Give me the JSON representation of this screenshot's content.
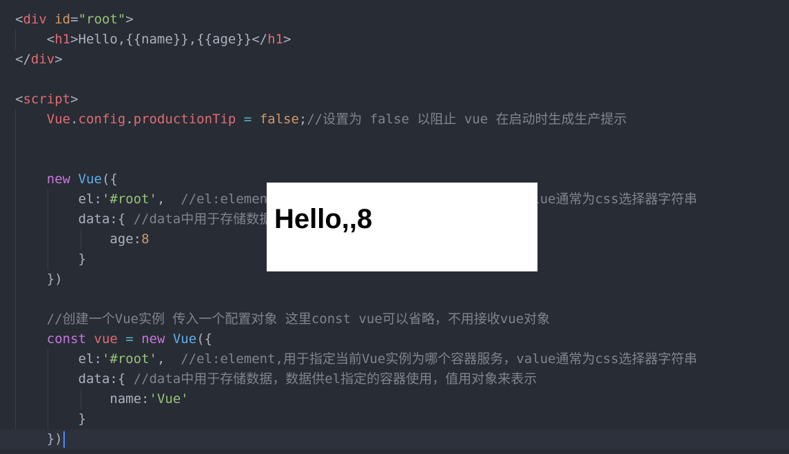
{
  "editor": {
    "lines": [
      [
        {
          "t": "<",
          "c": "t-punct"
        },
        {
          "t": "div",
          "c": "t-tag"
        },
        {
          "t": " ",
          "c": "t-text"
        },
        {
          "t": "id",
          "c": "t-attr"
        },
        {
          "t": "=",
          "c": "t-punct"
        },
        {
          "t": "\"root\"",
          "c": "t-str"
        },
        {
          "t": ">",
          "c": "t-punct"
        }
      ],
      [
        {
          "t": "    <",
          "c": "t-punct"
        },
        {
          "t": "h1",
          "c": "t-tag"
        },
        {
          "t": ">",
          "c": "t-punct"
        },
        {
          "t": "Hello,{{name}},{{age}}",
          "c": "t-text"
        },
        {
          "t": "</",
          "c": "t-punct"
        },
        {
          "t": "h1",
          "c": "t-tag"
        },
        {
          "t": ">",
          "c": "t-punct"
        }
      ],
      [
        {
          "t": "</",
          "c": "t-punct"
        },
        {
          "t": "div",
          "c": "t-tag"
        },
        {
          "t": ">",
          "c": "t-punct"
        }
      ],
      [],
      [
        {
          "t": "<",
          "c": "t-punct"
        },
        {
          "t": "script",
          "c": "t-tag"
        },
        {
          "t": ">",
          "c": "t-punct"
        }
      ],
      [
        {
          "t": "    ",
          "c": "t-text"
        },
        {
          "t": "Vue",
          "c": "t-var"
        },
        {
          "t": ".",
          "c": "t-punct"
        },
        {
          "t": "config",
          "c": "t-var"
        },
        {
          "t": ".",
          "c": "t-punct"
        },
        {
          "t": "productionTip",
          "c": "t-var"
        },
        {
          "t": " = ",
          "c": "t-op"
        },
        {
          "t": "false",
          "c": "t-bool"
        },
        {
          "t": ";",
          "c": "t-punct"
        },
        {
          "t": "//设置为 false 以阻止 vue 在启动时生成生产提示",
          "c": "t-comment"
        }
      ],
      [],
      [],
      [
        {
          "t": "    ",
          "c": "t-text"
        },
        {
          "t": "new",
          "c": "t-kw"
        },
        {
          "t": " ",
          "c": "t-text"
        },
        {
          "t": "Vue",
          "c": "t-fn"
        },
        {
          "t": "({",
          "c": "t-punct"
        }
      ],
      [
        {
          "t": "        ",
          "c": "t-text"
        },
        {
          "t": "el",
          "c": "t-prop"
        },
        {
          "t": ":",
          "c": "t-punct"
        },
        {
          "t": "'#root'",
          "c": "t-str"
        },
        {
          "t": ",  ",
          "c": "t-punct"
        },
        {
          "t": "//el:element,用于指定当前Vue实例为哪个容器服务，value通常为css选择器字符串",
          "c": "t-comment"
        }
      ],
      [
        {
          "t": "        ",
          "c": "t-text"
        },
        {
          "t": "data",
          "c": "t-prop"
        },
        {
          "t": ":{ ",
          "c": "t-punct"
        },
        {
          "t": "//data中用于存储数据，数据供el指定的容器使用，值用对象来表示",
          "c": "t-comment"
        }
      ],
      [
        {
          "t": "            ",
          "c": "t-text"
        },
        {
          "t": "age",
          "c": "t-prop"
        },
        {
          "t": ":",
          "c": "t-punct"
        },
        {
          "t": "8",
          "c": "t-num"
        }
      ],
      [
        {
          "t": "        }",
          "c": "t-punct"
        }
      ],
      [
        {
          "t": "    })",
          "c": "t-punct"
        }
      ],
      [],
      [
        {
          "t": "    ",
          "c": "t-text"
        },
        {
          "t": "//创建一个Vue实例 传入一个配置对象 这里const vue可以省略，不用接收vue对象",
          "c": "t-comment"
        }
      ],
      [
        {
          "t": "    ",
          "c": "t-text"
        },
        {
          "t": "const",
          "c": "t-kw"
        },
        {
          "t": " ",
          "c": "t-text"
        },
        {
          "t": "vue",
          "c": "t-var"
        },
        {
          "t": " = ",
          "c": "t-op"
        },
        {
          "t": "new",
          "c": "t-kw"
        },
        {
          "t": " ",
          "c": "t-text"
        },
        {
          "t": "Vue",
          "c": "t-fn"
        },
        {
          "t": "({",
          "c": "t-punct"
        }
      ],
      [
        {
          "t": "        ",
          "c": "t-text"
        },
        {
          "t": "el",
          "c": "t-prop"
        },
        {
          "t": ":",
          "c": "t-punct"
        },
        {
          "t": "'#root'",
          "c": "t-str"
        },
        {
          "t": ",  ",
          "c": "t-punct"
        },
        {
          "t": "//el:element,用于指定当前Vue实例为哪个容器服务，value通常为css选择器字符串",
          "c": "t-comment"
        }
      ],
      [
        {
          "t": "        ",
          "c": "t-text"
        },
        {
          "t": "data",
          "c": "t-prop"
        },
        {
          "t": ":{ ",
          "c": "t-punct"
        },
        {
          "t": "//data中用于存储数据，数据供el指定的容器使用，值用对象来表示",
          "c": "t-comment"
        }
      ],
      [
        {
          "t": "            ",
          "c": "t-text"
        },
        {
          "t": "name",
          "c": "t-prop"
        },
        {
          "t": ":",
          "c": "t-punct"
        },
        {
          "t": "'Vue'",
          "c": "t-str"
        }
      ],
      [
        {
          "t": "        }",
          "c": "t-punct"
        }
      ],
      [
        {
          "t": "    })",
          "c": "t-punct"
        }
      ]
    ],
    "current_line": 21
  },
  "preview": {
    "heading": "Hello,,8"
  },
  "colors": {
    "background": "#282c34",
    "current_line": "#2c313c",
    "tag": "#e06c75",
    "string": "#98c379",
    "keyword": "#c678dd",
    "function": "#61afef",
    "number": "#d19a66",
    "comment": "#7f848e",
    "cursor": "#528bff"
  }
}
